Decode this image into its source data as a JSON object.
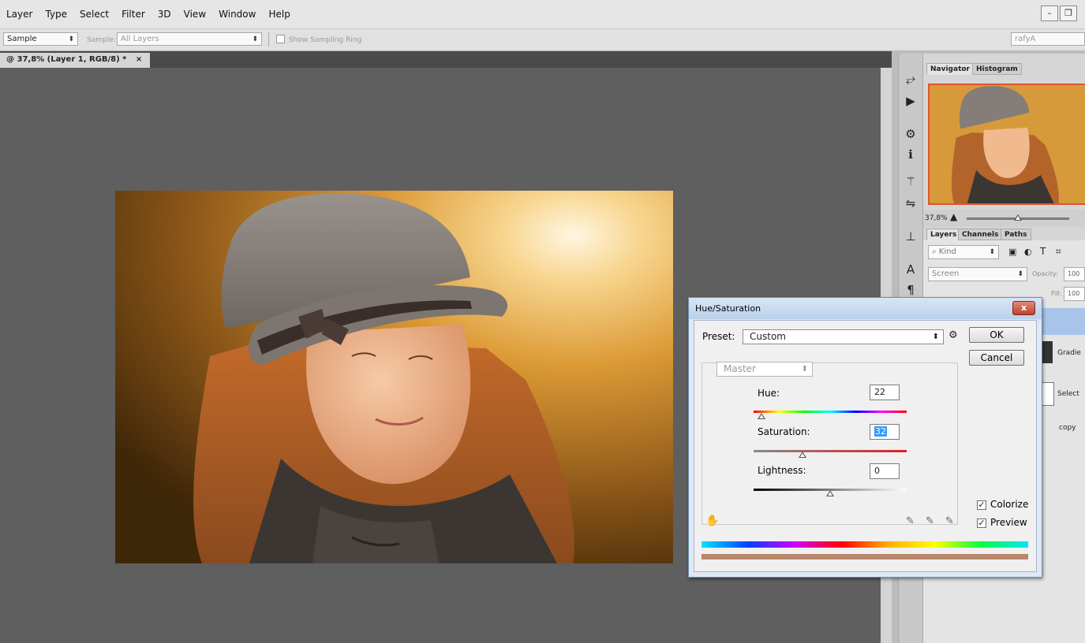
{
  "menu": {
    "items": [
      "Layer",
      "Type",
      "Select",
      "Filter",
      "3D",
      "View",
      "Window",
      "Help"
    ]
  },
  "window_controls": {
    "minimize": "–",
    "restore": "❐"
  },
  "options_bar": {
    "sample_size": "Sample",
    "sample_label": "Sample:",
    "sample_value": "All Layers",
    "show_sampling_ring": "Show Sampling Ring",
    "workspace": "rafyA"
  },
  "document_tab": {
    "title": "@ 37,8% (Layer 1, RGB/8) *",
    "close": "×"
  },
  "navigator": {
    "tabs": [
      "Navigator",
      "Histogram"
    ],
    "zoom": "37,8%",
    "zoom_fraction": 0.5
  },
  "layers": {
    "tabs": [
      "Layers",
      "Channels",
      "Paths"
    ],
    "kind": "Kind",
    "blend_mode": "Screen",
    "opacity_label": "Opacity:",
    "opacity_value": "100",
    "fill_label": "Fill:",
    "fill_value": "100",
    "rows": [
      "Gradie",
      "Select",
      "copy"
    ]
  },
  "dialog": {
    "title": "Hue/Saturation",
    "close": "x",
    "preset_label": "Preset:",
    "preset_value": "Custom",
    "ok": "OK",
    "cancel": "Cancel",
    "channel": "Master",
    "hue_label": "Hue:",
    "hue_value": "22",
    "saturation_label": "Saturation:",
    "saturation_value": "32",
    "lightness_label": "Lightness:",
    "lightness_value": "0",
    "colorize": "Colorize",
    "colorize_checked": true,
    "preview": "Preview",
    "preview_checked": true,
    "colorize_swatch": "#b8866a"
  }
}
